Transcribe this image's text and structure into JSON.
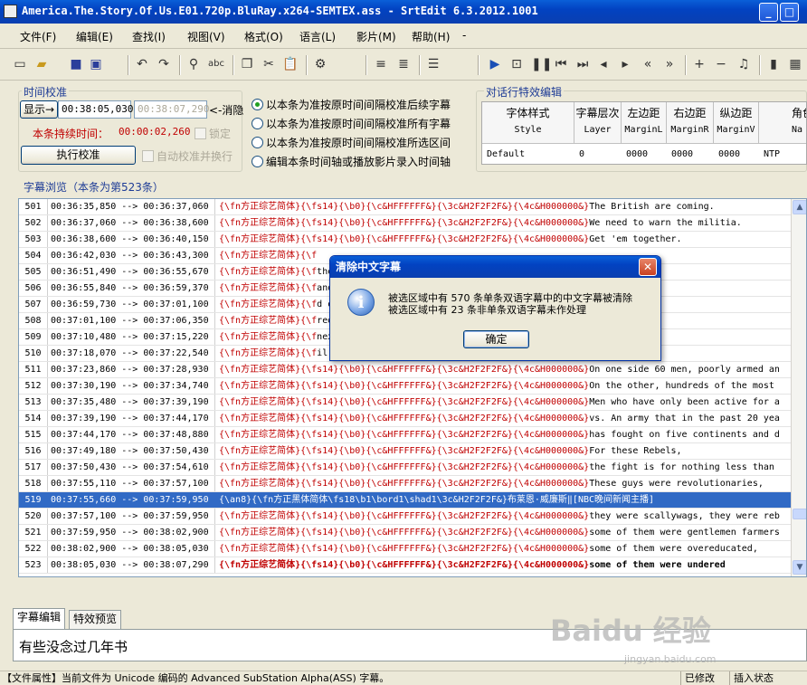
{
  "window": {
    "title": "America.The.Story.Of.Us.E01.720p.BluRay.x264-SEMTEX.ass - SrtEdit 6.3.2012.1001",
    "minimize_glyph": "_",
    "maximize_glyph": "□",
    "close_glyph": "✕",
    "app_icon": "srtedit-app-icon"
  },
  "menu": [
    "文件(F)",
    "编辑(E)",
    "查找(I)",
    "视图(V)",
    "格式(O)",
    "语言(L)",
    "影片(M)",
    "帮助(H)",
    "-"
  ],
  "toolbar_icons": [
    "new-file-icon",
    "open-file-icon",
    "save-icon",
    "save-as-icon",
    "undo-icon",
    "redo-icon",
    "find-icon",
    "spellcheck-icon",
    "copy-icon",
    "cut-icon",
    "paste-icon",
    "settings-icon",
    "align-left-icon",
    "align-justify-icon",
    "list-icon",
    "play-icon",
    "frame-icon",
    "pause-icon",
    "prev-icon",
    "next-icon",
    "back-icon",
    "forward-icon",
    "rewind-icon",
    "fast-forward-icon",
    "zoom-in-icon",
    "zoom-out-icon",
    "music-icon",
    "film-icon",
    "grid-icon"
  ],
  "time_calibration": {
    "group_label": "时间校准",
    "display_label": "显示→",
    "display_value": "00:38:05,030",
    "target_value": "00:38:07,290",
    "cancel_label": "<-消隐",
    "duration_label": "本条持续时间：",
    "duration_value": "00:00:02,260",
    "lock_label": "锁定",
    "execute_label": "执行校准",
    "auto_label": "自动校准并换行",
    "options": [
      {
        "label": "以本条为准按原时间间隔校准后续字幕",
        "selected": true
      },
      {
        "label": "以本条为准按原时间间隔校准所有字幕",
        "selected": false
      },
      {
        "label": "以本条为准按原时间间隔校准所选区间",
        "selected": false
      },
      {
        "label": "编辑本条时间轴或播放影片录入时间轴",
        "selected": false
      }
    ]
  },
  "style_edit": {
    "group_label": "对话行特效编辑",
    "headers": [
      {
        "zh": "字体样式",
        "en": "Style"
      },
      {
        "zh": "字幕层次",
        "en": "Layer"
      },
      {
        "zh": "左边距",
        "en": "MarginL"
      },
      {
        "zh": "右边距",
        "en": "MarginR"
      },
      {
        "zh": "纵边距",
        "en": "MarginV"
      },
      {
        "zh": "角色",
        "en": "Na"
      }
    ],
    "row": [
      "Default",
      "0",
      "0000",
      "0000",
      "0000",
      "NTP"
    ]
  },
  "subtitle_browser": {
    "label": "字幕浏览（本条为第523条）",
    "rows": [
      {
        "n": "501",
        "t": "00:36:35,850 --> 00:36:37,060",
        "tag": "{\\fn方正综艺简体}{\\fs14}{\\b0}{\\c&HFFFFFF&}{\\3c&H2F2F2F&}{\\4c&H000000&}",
        "text": "The British are coming.",
        "sel": false,
        "bold": false
      },
      {
        "n": "502",
        "t": "00:36:37,060 --> 00:36:38,600",
        "tag": "{\\fn方正综艺简体}{\\fs14}{\\b0}{\\c&HFFFFFF&}{\\3c&H2F2F2F&}{\\4c&H000000&}",
        "text": "We need to warn the militia.",
        "sel": false,
        "bold": false
      },
      {
        "n": "503",
        "t": "00:36:38,600 --> 00:36:40,150",
        "tag": "{\\fn方正综艺简体}{\\fs14}{\\b0}{\\c&HFFFFFF&}{\\3c&H2F2F2F&}{\\4c&H000000&}",
        "text": "Get 'em together.",
        "sel": false,
        "bold": false
      },
      {
        "n": "504",
        "t": "00:36:42,030 --> 00:36:43,300",
        "tag": "{\\fn方正综艺简体}{\\f",
        "text": "",
        "sel": false,
        "bold": false
      },
      {
        "n": "505",
        "t": "00:36:51,490 --> 00:36:55,670",
        "tag": "{\\fn方正综艺简体}{\\f",
        "text": "the morning, 60 militiam",
        "sel": false,
        "bold": false
      },
      {
        "n": "506",
        "t": "00:36:55,840 --> 00:36:59,370",
        "tag": "{\\fn方正综艺简体}{\\f",
        "text": "anded by a farmer, John",
        "sel": false,
        "bold": false
      },
      {
        "n": "507",
        "t": "00:36:59,730 --> 00:37:01,100",
        "tag": "{\\fn方正综艺简体}{\\f",
        "text": "d off",
        "sel": false,
        "bold": false
      },
      {
        "n": "508",
        "t": "00:37:01,100 --> 00:37:06,350",
        "tag": "{\\fn方正综艺简体}{\\f",
        "text": "reds of well-armed and",
        "sel": false,
        "bold": false
      },
      {
        "n": "509",
        "t": "00:37:10,480 --> 00:37:15,220",
        "tag": "{\\fn方正综艺简体}{\\f",
        "text": "next will transform th",
        "sel": false,
        "bold": false
      },
      {
        "n": "510",
        "t": "00:37:18,070 --> 00:37:22,540",
        "tag": "{\\fn方正综艺简体}{\\f",
        "text": "il 19, 1775.",
        "sel": false,
        "bold": false
      },
      {
        "n": "511",
        "t": "00:37:23,860 --> 00:37:28,930",
        "tag": "{\\fn方正综艺简体}{\\fs14}{\\b0}{\\c&HFFFFFF&}{\\3c&H2F2F2F&}{\\4c&H000000&}",
        "text": "On one side 60 men, poorly armed an",
        "sel": false,
        "bold": false
      },
      {
        "n": "512",
        "t": "00:37:30,190 --> 00:37:34,740",
        "tag": "{\\fn方正综艺简体}{\\fs14}{\\b0}{\\c&HFFFFFF&}{\\3c&H2F2F2F&}{\\4c&H000000&}",
        "text": "On the other, hundreds of the most",
        "sel": false,
        "bold": false
      },
      {
        "n": "513",
        "t": "00:37:35,480 --> 00:37:39,190",
        "tag": "{\\fn方正综艺简体}{\\fs14}{\\b0}{\\c&HFFFFFF&}{\\3c&H2F2F2F&}{\\4c&H000000&}",
        "text": "Men who have only been active for a",
        "sel": false,
        "bold": false
      },
      {
        "n": "514",
        "t": "00:37:39,190 --> 00:37:44,170",
        "tag": "{\\fn方正综艺简体}{\\fs14}{\\b0}{\\c&HFFFFFF&}{\\3c&H2F2F2F&}{\\4c&H000000&}",
        "text": "vs. An army that in the past 20 yea",
        "sel": false,
        "bold": false
      },
      {
        "n": "515",
        "t": "00:37:44,170 --> 00:37:48,880",
        "tag": "{\\fn方正综艺简体}{\\fs14}{\\b0}{\\c&HFFFFFF&}{\\3c&H2F2F2F&}{\\4c&H000000&}",
        "text": "has fought on five continents and d",
        "sel": false,
        "bold": false
      },
      {
        "n": "516",
        "t": "00:37:49,180 --> 00:37:50,430",
        "tag": "{\\fn方正综艺简体}{\\fs14}{\\b0}{\\c&HFFFFFF&}{\\3c&H2F2F2F&}{\\4c&H000000&}",
        "text": "For these Rebels,",
        "sel": false,
        "bold": false
      },
      {
        "n": "517",
        "t": "00:37:50,430 --> 00:37:54,610",
        "tag": "{\\fn方正综艺简体}{\\fs14}{\\b0}{\\c&HFFFFFF&}{\\3c&H2F2F2F&}{\\4c&H000000&}",
        "text": "the fight is for nothing less than",
        "sel": false,
        "bold": false
      },
      {
        "n": "518",
        "t": "00:37:55,110 --> 00:37:57,100",
        "tag": "{\\fn方正综艺简体}{\\fs14}{\\b0}{\\c&HFFFFFF&}{\\3c&H2F2F2F&}{\\4c&H000000&}",
        "text": "These guys were revolutionaries,",
        "sel": false,
        "bold": false
      },
      {
        "n": "519",
        "t": "00:37:55,660 --> 00:37:59,950",
        "tag": "{\\an8}{\\fn方正黑体简体\\fs18\\b1\\bord1\\shad1\\3c&H2F2F2F&}",
        "text": "布莱恩·威廉斯‖[NBC晚间新闻主播]",
        "sel": true,
        "bold": false
      },
      {
        "n": "520",
        "t": "00:37:57,100 --> 00:37:59,950",
        "tag": "{\\fn方正综艺简体}{\\fs14}{\\b0}{\\c&HFFFFFF&}{\\3c&H2F2F2F&}{\\4c&H000000&}",
        "text": "they were scallywags, they were reb",
        "sel": false,
        "bold": false
      },
      {
        "n": "521",
        "t": "00:37:59,950 --> 00:38:02,900",
        "tag": "{\\fn方正综艺简体}{\\fs14}{\\b0}{\\c&HFFFFFF&}{\\3c&H2F2F2F&}{\\4c&H000000&}",
        "text": "some of them were gentlemen farmers",
        "sel": false,
        "bold": false
      },
      {
        "n": "522",
        "t": "00:38:02,900 --> 00:38:05,030",
        "tag": "{\\fn方正综艺简体}{\\fs14}{\\b0}{\\c&HFFFFFF&}{\\3c&H2F2F2F&}{\\4c&H000000&}",
        "text": "some of them were overeducated,",
        "sel": false,
        "bold": false
      },
      {
        "n": "523",
        "t": "00:38:05,030 --> 00:38:07,290",
        "tag": "{\\fn方正综艺简体}{\\fs14}{\\b0}{\\c&HFFFFFF&}{\\3c&H2F2F2F&}{\\4c&H000000&}",
        "text": "some of them were undered",
        "sel": false,
        "bold": true
      }
    ]
  },
  "dialog": {
    "title": "清除中文字幕",
    "line1": "被选区域中有 570 条单条双语字幕中的中文字幕被清除",
    "line2": "被选区域中有 23 条非单条双语字幕未作处理",
    "ok_label": "确定",
    "close_glyph": "✕",
    "icon_glyph": "i"
  },
  "bottom_tabs": [
    "字幕编辑",
    "特效预览"
  ],
  "edit_text": "有些没念过几年书",
  "status": {
    "left": "【文件属性】当前文件为 Unicode 编码的 Advanced SubStation Alpha(ASS) 字幕。",
    "mid": "已修改",
    "right": "插入状态"
  },
  "watermark": {
    "logo": "Baidu 经验",
    "url": "jingyan.baidu.com"
  }
}
